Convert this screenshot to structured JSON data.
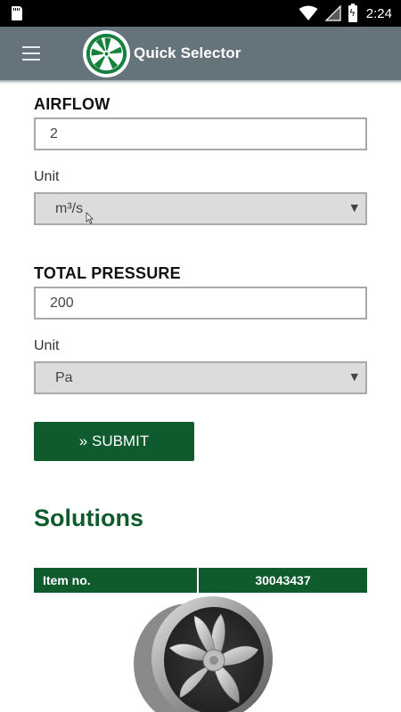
{
  "status_bar": {
    "time": "2:24",
    "icons": [
      "sd-card-icon",
      "wifi-icon",
      "signal-icon",
      "battery-charging-icon"
    ]
  },
  "app_bar": {
    "title": "Quick Selector",
    "menu_icon": "hamburger-menu-icon",
    "logo": "fan-logo"
  },
  "form": {
    "airflow": {
      "label": "AIRFLOW",
      "value": "2",
      "unit_label": "Unit",
      "unit_value": "m³/s"
    },
    "total_pressure": {
      "label": "TOTAL PRESSURE",
      "value": "200",
      "unit_label": "Unit",
      "unit_value": "Pa"
    },
    "submit_label": "» SUBMIT"
  },
  "solutions": {
    "title": "Solutions",
    "table": {
      "header_label": "Item no.",
      "header_value": "30043437"
    }
  },
  "colors": {
    "brand_green": "#0f5b2e",
    "app_bar": "#65737a",
    "select_bg": "#dcdcdc",
    "border": "#a9a9a9"
  }
}
